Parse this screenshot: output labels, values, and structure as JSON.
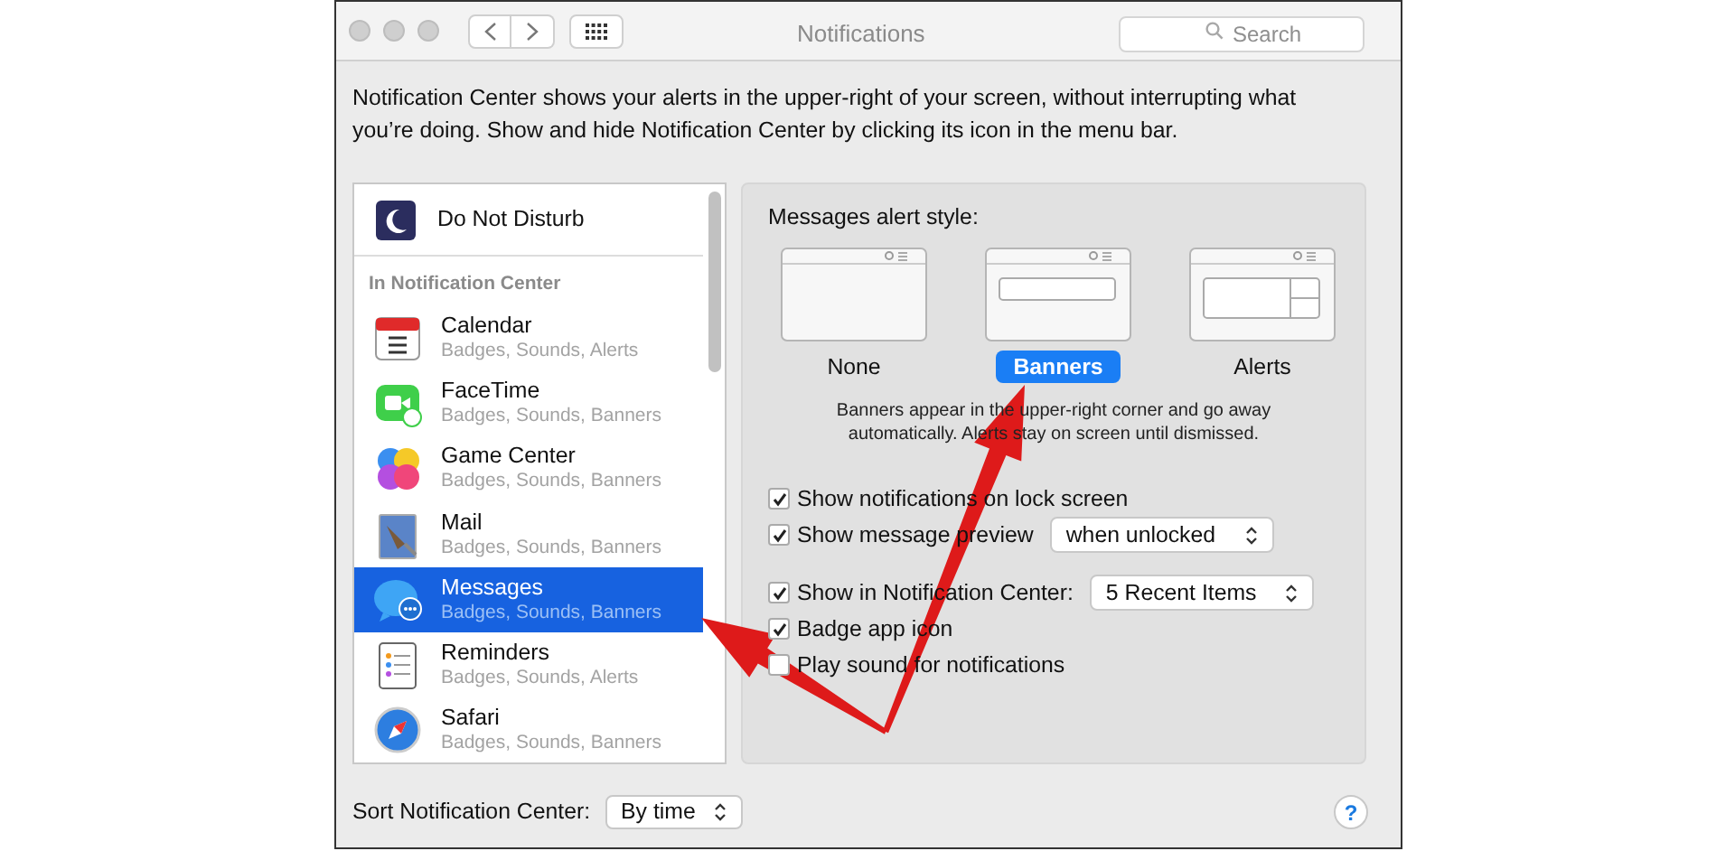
{
  "window": {
    "title": "Notifications"
  },
  "search": {
    "placeholder": "Search"
  },
  "description": "Notification Center shows your alerts in the upper-right of your screen, without interrupting what you’re doing. Show and hide Notification Center by clicking its icon in the menu bar.",
  "do_not_disturb": {
    "label": "Do Not Disturb",
    "selected": false
  },
  "list_section": "In Notification Center",
  "apps": [
    {
      "name": "Calendar",
      "detail": "Badges, Sounds, Alerts",
      "selected": false
    },
    {
      "name": "FaceTime",
      "detail": "Badges, Sounds, Banners",
      "selected": false
    },
    {
      "name": "Game Center",
      "detail": "Badges, Sounds, Banners",
      "selected": false
    },
    {
      "name": "Mail",
      "detail": "Badges, Sounds, Banners",
      "selected": false
    },
    {
      "name": "Messages",
      "detail": "Badges, Sounds, Banners",
      "selected": true
    },
    {
      "name": "Reminders",
      "detail": "Badges, Sounds, Alerts",
      "selected": false
    },
    {
      "name": "Safari",
      "detail": "Badges, Sounds, Banners",
      "selected": false
    }
  ],
  "alert_style": {
    "label": "Messages alert style:",
    "options": [
      {
        "label": "None",
        "selected": false
      },
      {
        "label": "Banners",
        "selected": true
      },
      {
        "label": "Alerts",
        "selected": false
      }
    ],
    "help": "Banners appear in the upper-right corner and go away automatically. Alerts stay on screen until dismissed."
  },
  "option_groups": [
    [
      {
        "label": "Show notifications on lock screen",
        "checked": true
      },
      {
        "label": "Show message preview",
        "checked": true,
        "dropdown": "when unlocked"
      }
    ],
    [
      {
        "label": "Show in Notification Center:",
        "checked": true,
        "dropdown": "5 Recent Items"
      },
      {
        "label": "Badge app icon",
        "checked": true
      },
      {
        "label": "Play sound for notifications",
        "checked": false
      }
    ]
  ],
  "sort": {
    "label": "Sort Notification Center:",
    "value": "By time"
  },
  "help_button": "?"
}
